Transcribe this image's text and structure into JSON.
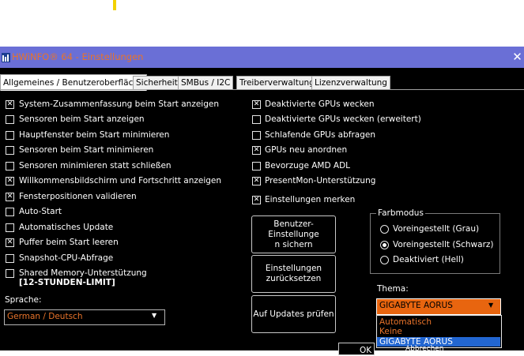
{
  "window": {
    "title": "HWiNFO® 64 - Einstellungen",
    "close_glyph": "✕"
  },
  "tabs": [
    {
      "label": "Allgemeines / Benutzeroberfläche",
      "active": true
    },
    {
      "label": "Sicherheit",
      "active": false
    },
    {
      "label": "SMBus / I2C",
      "active": false
    },
    {
      "label": "Treiberverwaltung",
      "active": false
    },
    {
      "label": "Lizenzverwaltung",
      "active": false
    }
  ],
  "left_options": [
    {
      "label": "System-Zusammenfassung beim Start anzeigen",
      "checked": true
    },
    {
      "label": "Sensoren beim Start anzeigen",
      "checked": false
    },
    {
      "label": "Hauptfenster beim Start minimieren",
      "checked": false
    },
    {
      "label": "Sensoren beim Start minimieren",
      "checked": false
    },
    {
      "label": "Sensoren minimieren statt schließen",
      "checked": false
    },
    {
      "label": "Willkommensbildschirm und Fortschritt anzeigen",
      "checked": true
    },
    {
      "label": "Fensterpositionen validieren",
      "checked": true
    },
    {
      "label": "Auto-Start",
      "checked": false
    },
    {
      "label": "Automatisches Update",
      "checked": false
    },
    {
      "label": "Puffer beim Start leeren",
      "checked": true
    },
    {
      "label": "Snapshot-CPU-Abfrage",
      "checked": false
    },
    {
      "label": "Shared Memory-Unterstützung",
      "checked": false
    }
  ],
  "shared_memory_note": "[12-STUNDEN-LIMIT]",
  "right_options": [
    {
      "label": "Deaktivierte GPUs wecken",
      "checked": true
    },
    {
      "label": "Deaktivierte GPUs wecken (erweitert)",
      "checked": false
    },
    {
      "label": "Schlafende GPUs abfragen",
      "checked": false
    },
    {
      "label": "GPUs neu anordnen",
      "checked": true
    },
    {
      "label": "Bevorzuge AMD ADL",
      "checked": false
    },
    {
      "label": "PresentMon-Unterstützung",
      "checked": true
    },
    {
      "label": "Einstellungen merken",
      "checked": true
    }
  ],
  "buttons": {
    "save_user_settings_line1": "Benutzer-Einstellunge",
    "save_user_settings_line2": "n sichern",
    "reset_settings_line1": "Einstellungen",
    "reset_settings_line2": "zurücksetzen",
    "check_updates": "Auf Updates prüfen",
    "ok": "OK",
    "cancel": "Abbrechen"
  },
  "color_mode": {
    "title": "Farbmodus",
    "options": [
      {
        "label": "Voreingestellt (Grau)",
        "selected": false
      },
      {
        "label": "Voreingestellt (Schwarz)",
        "selected": true
      },
      {
        "label": "Deaktiviert (Hell)",
        "selected": false
      }
    ]
  },
  "language": {
    "label": "Sprache:",
    "value": "German / Deutsch"
  },
  "theme": {
    "label": "Thema:",
    "value": "GIGABYTE AORUS",
    "options": [
      "Automatisch",
      "Keine",
      "GIGABYTE AORUS"
    ]
  },
  "colors": {
    "title_bar": "#6a6fd6",
    "accent_orange": "#e8650f",
    "selection_blue": "#2266d1",
    "background": "#000000"
  }
}
